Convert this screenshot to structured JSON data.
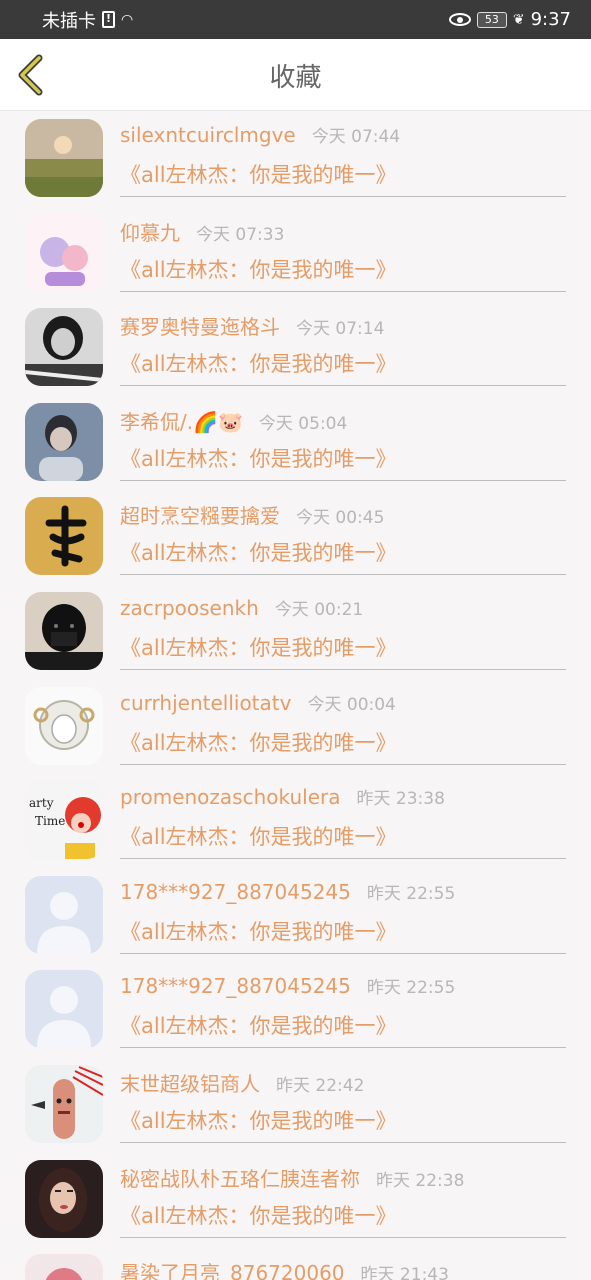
{
  "status_bar": {
    "carrier": "未插卡",
    "battery": "53",
    "time": "9:37"
  },
  "nav": {
    "title": "收藏",
    "accent": "#d4c74a"
  },
  "colors": {
    "name_color": "#e59d68",
    "time_color": "#b7b7b7"
  },
  "items": [
    {
      "name": "silexntcuirclmgve",
      "time": "今天 07:44",
      "book": "《all左林杰：你是我的唯一》",
      "avatar": "sunset-landscape"
    },
    {
      "name": "仰慕九",
      "time": "今天 07:33",
      "book": "《all左林杰：你是我的唯一》",
      "avatar": "cartoon-characters"
    },
    {
      "name": "赛罗奥特曼迤格斗",
      "time": "今天 07:14",
      "book": "《all左林杰：你是我的唯一》",
      "avatar": "bw-girl-photo"
    },
    {
      "name": "李希侃/.🌈🐷",
      "time": "今天 05:04",
      "book": "《all左林杰：你是我的唯一》",
      "avatar": "boy-photo"
    },
    {
      "name": "超时烹空糨要擒爱",
      "time": "今天 00:45",
      "book": "《all左林杰：你是我的唯一》",
      "avatar": "fu-calligraphy"
    },
    {
      "name": "zacrpoosenkh",
      "time": "今天 00:21",
      "book": "《all左林杰：你是我的唯一》",
      "avatar": "anime-dark-boy"
    },
    {
      "name": "currhjentelliotatv",
      "time": "今天 00:04",
      "book": "《all左林杰：你是我的唯一》",
      "avatar": "sheep-drawing"
    },
    {
      "name": "promenozaschokulera",
      "time": "昨天 23:38",
      "book": "《all左林杰：你是我的唯一》",
      "avatar": "clown-party"
    },
    {
      "name": "178***927_887045245",
      "time": "昨天 22:55",
      "book": "《all左林杰：你是我的唯一》",
      "avatar": "default-avatar"
    },
    {
      "name": "178***927_887045245",
      "time": "昨天 22:55",
      "book": "《all左林杰：你是我的唯一》",
      "avatar": "default-avatar"
    },
    {
      "name": "末世超级铝商人",
      "time": "昨天 22:42",
      "book": "《all左林杰：你是我的唯一》",
      "avatar": "finger-face"
    },
    {
      "name": "秘密战队朴五珞仁胰连者祢",
      "time": "昨天 22:38",
      "book": "《all左林杰：你是我的唯一》",
      "avatar": "woman-photo"
    },
    {
      "name": "暑染了月亮_876720060",
      "time": "昨天 21:43",
      "book": "",
      "avatar": "pink-avatar"
    }
  ]
}
